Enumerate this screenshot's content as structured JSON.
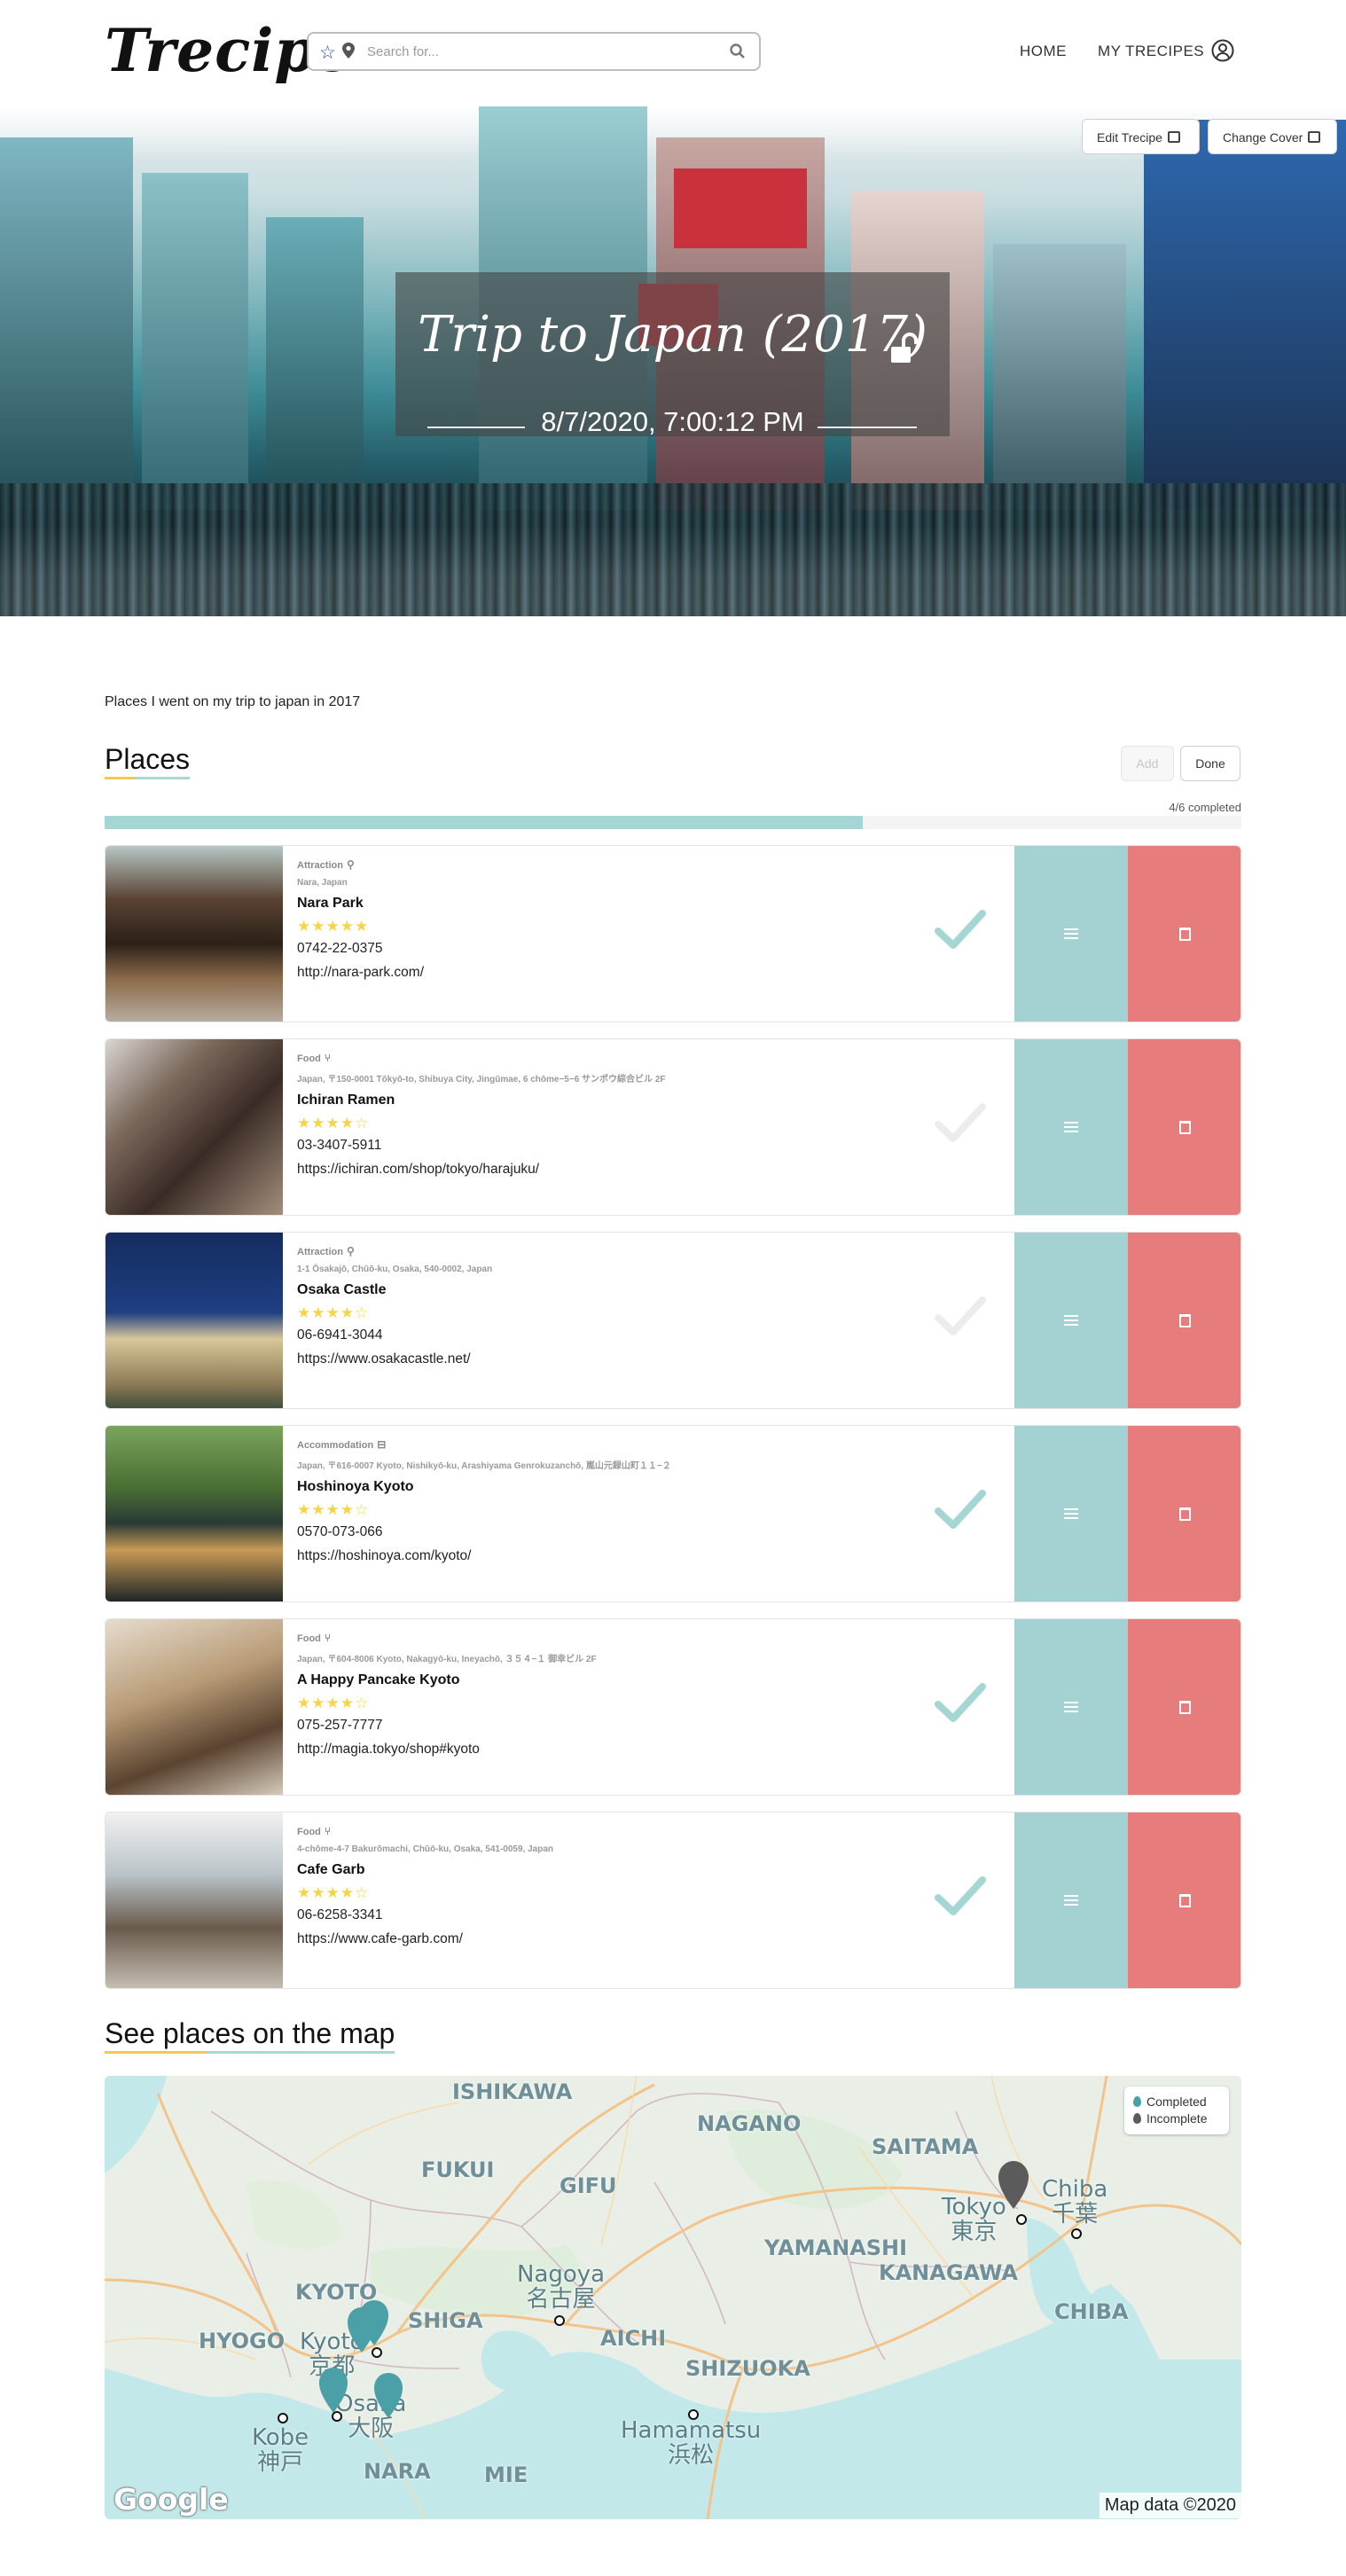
{
  "header": {
    "logo": "Trecipe",
    "search_placeholder": "Search for...",
    "nav_home": "HOME",
    "nav_my": "MY TRECIPES"
  },
  "hero": {
    "title": "Trip to Japan (2017)",
    "date": "8/7/2020, 7:00:12 PM",
    "edit_label": "Edit Trecipe",
    "cover_label": "Change Cover"
  },
  "description": "Places I went on my trip to japan in 2017",
  "places": {
    "heading": "Places",
    "add_label": "Add",
    "done_label": "Done",
    "progress_label": "4/6 completed",
    "progress_fraction": 0.667,
    "items": [
      {
        "category": "Attraction",
        "icon": "binoculars-icon",
        "address": "Nara, Japan",
        "name": "Nara Park",
        "rating": 5,
        "stars": "★★★★★",
        "phone": "0742-22-0375",
        "url": "http://nara-park.com/",
        "completed": true
      },
      {
        "category": "Food",
        "icon": "utensils-icon",
        "address": "Japan, 〒150-0001 Tōkyō-to, Shibuya City, Jingūmae, 6 chōme−5−6 サンポウ綜合ビル 2F",
        "name": "Ichiran Ramen",
        "rating": 4,
        "stars": "★★★★☆",
        "phone": "03-3407-5911",
        "url": "https://ichiran.com/shop/tokyo/harajuku/",
        "completed": false
      },
      {
        "category": "Attraction",
        "icon": "binoculars-icon",
        "address": "1-1 Ōsakajō, Chūō-ku, Osaka, 540-0002, Japan",
        "name": "Osaka Castle",
        "rating": 4,
        "stars": "★★★★☆",
        "phone": "06-6941-3044",
        "url": "https://www.osakacastle.net/",
        "completed": false
      },
      {
        "category": "Accommodation",
        "icon": "bed-icon",
        "address": "Japan, 〒616-0007 Kyoto, Nishikyō-ku, Arashiyama Genrokuzanchō, 嵐山元録山町１１−２",
        "name": "Hoshinoya Kyoto",
        "rating": 4,
        "stars": "★★★★☆",
        "phone": "0570-073-066",
        "url": "https://hoshinoya.com/kyoto/",
        "completed": true
      },
      {
        "category": "Food",
        "icon": "utensils-icon",
        "address": "Japan, 〒604-8006 Kyoto, Nakagyō-ku, Ineyachō, ３５４−１ 御幸ビル 2F",
        "name": "A Happy Pancake Kyoto",
        "rating": 4,
        "stars": "★★★★☆",
        "phone": "075-257-7777",
        "url": "http://magia.tokyo/shop#kyoto",
        "completed": true
      },
      {
        "category": "Food",
        "icon": "utensils-icon",
        "address": "4-chōme-4-7 Bakurōmachi, Chūō-ku, Osaka, 541-0059, Japan",
        "name": "Cafe Garb",
        "rating": 4,
        "stars": "★★★★☆",
        "phone": "06-6258-3341",
        "url": "https://www.cafe-garb.com/",
        "completed": true
      }
    ]
  },
  "map": {
    "heading": "See places on the map",
    "legend_completed": "Completed",
    "legend_incomplete": "Incomplete",
    "labels": {
      "ishikawa": "ISHIKAWA",
      "nagano": "NAGANO",
      "saitama": "SAITAMA",
      "fukui": "FUKUI",
      "gifu": "GIFU",
      "yamanashi": "YAMANASHI",
      "kanagawa": "KANAGAWA",
      "chiba_pref": "CHIBA",
      "kyoto_pref": "KYOTO",
      "hyogo": "HYOGO",
      "shiga": "SHIGA",
      "aichi": "AICHI",
      "shizuoka": "SHIZUOKA",
      "nara": "NARA",
      "mie": "MIE"
    },
    "cities": {
      "tokyo": "Tokyo\n東京",
      "chiba": "Chiba\n千葉",
      "nagoya": "Nagoya\n名古屋",
      "kyoto": "Kyoto\n京都",
      "osaka": "Osaka\n大阪",
      "kobe": "Kobe\n神戸",
      "hamamatsu": "Hamamatsu\n浜松"
    },
    "google": "Google",
    "attribution": "Map data ©2020"
  },
  "colors": {
    "accent_teal": "#a4d1d2",
    "delete_red": "#e67c7b",
    "star_yellow": "#f5d547",
    "check_done": "#a4d6d3",
    "check_pending": "#ececec"
  }
}
